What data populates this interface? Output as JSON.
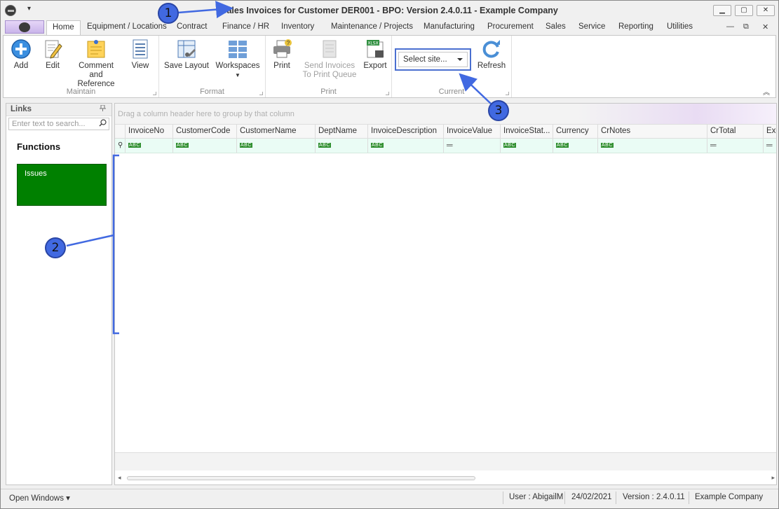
{
  "window": {
    "title": "Sales Invoices for Customer DER001 - BPO: Version 2.4.0.11 - Example Company",
    "controls": {
      "minimize": "▁",
      "restore": "▢",
      "close": "✕"
    },
    "qat_arrow": "▾"
  },
  "tabs": [
    {
      "label": "Home",
      "active": true
    },
    {
      "label": "Equipment / Locations"
    },
    {
      "label": "Contract"
    },
    {
      "label": "Finance / HR"
    },
    {
      "label": "Inventory"
    },
    {
      "label": "Maintenance / Projects"
    },
    {
      "label": "Manufacturing"
    },
    {
      "label": "Procurement"
    },
    {
      "label": "Sales"
    },
    {
      "label": "Service"
    },
    {
      "label": "Reporting"
    },
    {
      "label": "Utilities"
    }
  ],
  "mdi_controls": {
    "minimize": "—",
    "restore": "⧉",
    "close": "✕"
  },
  "ribbon": {
    "maintain": {
      "label": "Maintain",
      "add": "Add",
      "edit": "Edit",
      "comment_line1": "Comment and",
      "comment_line2": "Reference",
      "view": "View"
    },
    "format": {
      "label": "Format",
      "save_layout": "Save Layout",
      "workspaces": "Workspaces"
    },
    "print": {
      "label": "Print",
      "print": "Print",
      "send_line1": "Send Invoices",
      "send_line2": "To Print Queue",
      "export": "Export"
    },
    "current": {
      "label": "Current",
      "site_select": "Select site...",
      "refresh": "Refresh"
    },
    "collapse_glyph": "︽"
  },
  "links_panel": {
    "title": "Links",
    "pin_glyph": "ꟷ",
    "search_placeholder": "Enter text to search...",
    "functions_heading": "Functions",
    "tiles": [
      {
        "label": "Issues",
        "color": "#008000"
      }
    ]
  },
  "grid": {
    "group_panel_text": "Drag a column header here to group by that column",
    "columns": [
      {
        "label": "InvoiceNo",
        "filter": "abc"
      },
      {
        "label": "CustomerCode",
        "filter": "abc"
      },
      {
        "label": "CustomerName",
        "filter": "abc"
      },
      {
        "label": "DeptName",
        "filter": "abc"
      },
      {
        "label": "InvoiceDescription",
        "filter": "abc"
      },
      {
        "label": "InvoiceValue",
        "filter": "eq"
      },
      {
        "label": "InvoiceStat...",
        "filter": "abc"
      },
      {
        "label": "Currency",
        "filter": "abc"
      },
      {
        "label": "CrNotes",
        "filter": "abc"
      },
      {
        "label": "CrTotal",
        "filter": "eq"
      },
      {
        "label": "Exc",
        "filter": "eq"
      }
    ],
    "filter_abc_text": "ABC",
    "filter_eq_text": "═",
    "filter_row_icon": "⚲",
    "scroll_left": "◂",
    "scroll_right": "▸"
  },
  "statusbar": {
    "open_windows": "Open Windows ▾",
    "user": "User : AbigailM",
    "date": "24/02/2021",
    "version": "Version : 2.4.0.11",
    "company": "Example Company"
  },
  "callouts": {
    "one": "1",
    "two": "2",
    "three": "3"
  },
  "accent_color": "#4169e1"
}
